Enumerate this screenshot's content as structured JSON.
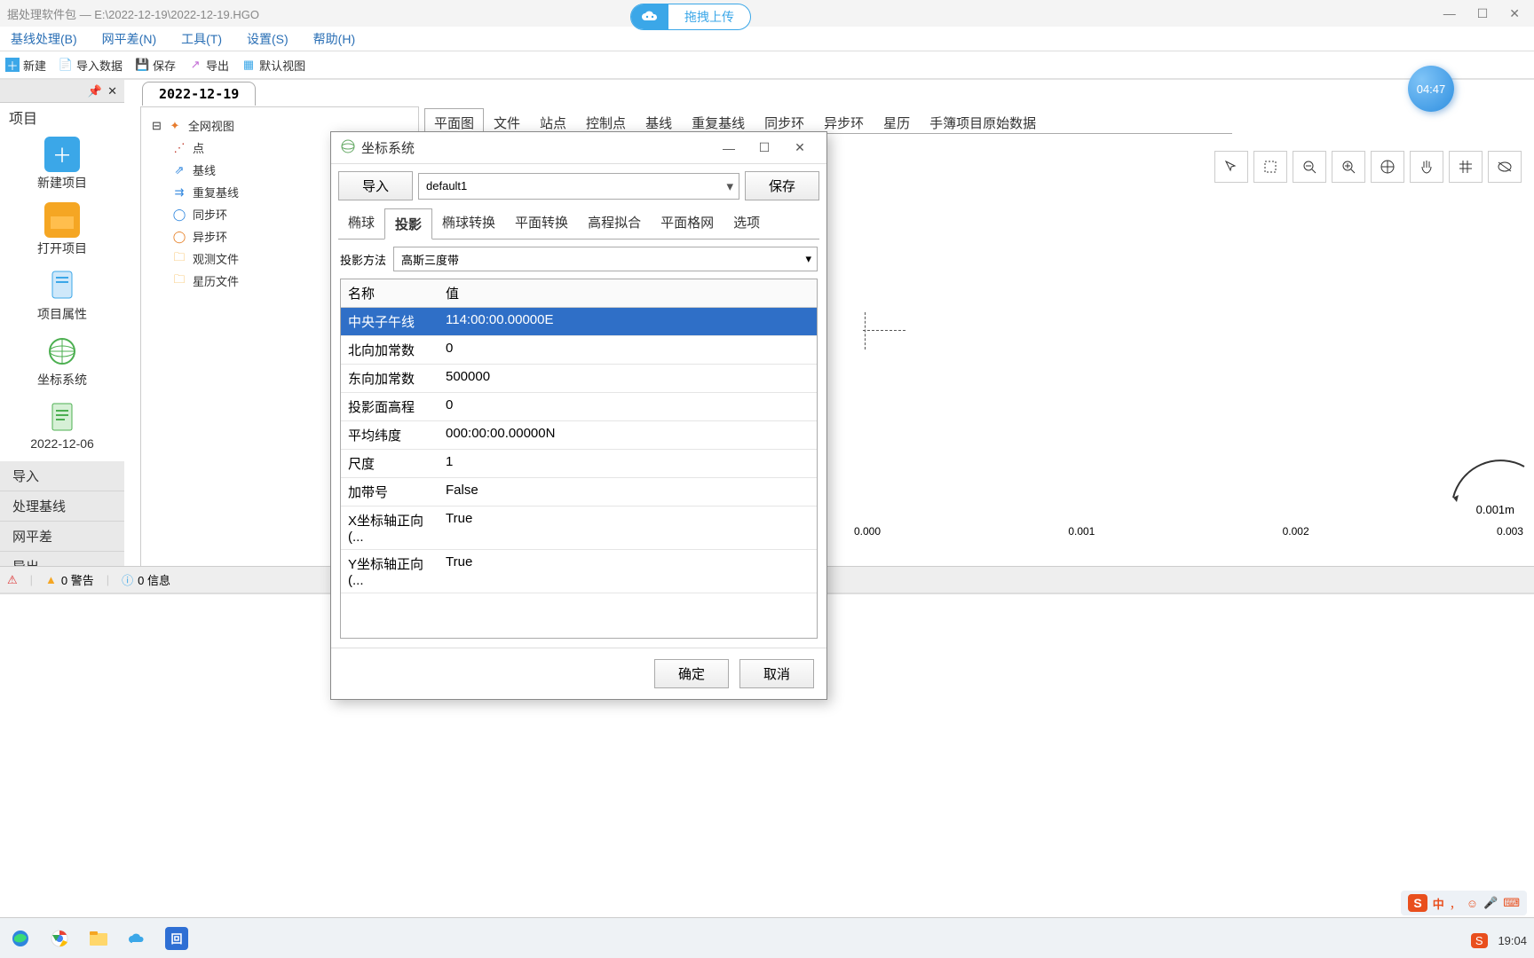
{
  "window": {
    "title": "据处理软件包 — E:\\2022-12-19\\2022-12-19.HGO",
    "upload_label": "拖拽上传"
  },
  "menu": {
    "items": [
      "基线处理(B)",
      "网平差(N)",
      "工具(T)",
      "设置(S)",
      "帮助(H)"
    ]
  },
  "toolbar": {
    "new": "新建",
    "import": "导入数据",
    "save": "保存",
    "export": "导出",
    "default_view": "默认视图"
  },
  "side": {
    "header": "项目",
    "pin": "📌",
    "items": [
      {
        "label": "新建项目"
      },
      {
        "label": "打开项目"
      },
      {
        "label": "项目属性"
      },
      {
        "label": "坐标系统"
      },
      {
        "label": "2022-12-06"
      }
    ],
    "actions": [
      "导入",
      "处理基线",
      "网平差",
      "导出"
    ]
  },
  "doc_tab": "2022-12-19",
  "tree": {
    "root": "全网视图",
    "children": [
      "点",
      "基线",
      "重复基线",
      "同步环",
      "异步环",
      "观测文件",
      "星历文件"
    ]
  },
  "map": {
    "tabs": [
      "平面图",
      "文件",
      "站点",
      "控制点",
      "基线",
      "重复基线",
      "同步环",
      "异步环",
      "星历",
      "手簿项目原始数据"
    ],
    "scale": "0.001m",
    "xticks": [
      "0.000",
      "0.001",
      "0.002",
      "0.003"
    ]
  },
  "dialog": {
    "title": "坐标系统",
    "import": "导入",
    "combo": "default1",
    "save": "保存",
    "tabs": [
      "椭球",
      "投影",
      "椭球转换",
      "平面转换",
      "高程拟合",
      "平面格网",
      "选项"
    ],
    "active_tab": 1,
    "proj_method_label": "投影方法",
    "proj_method_value": "高斯三度带",
    "col_name": "名称",
    "col_value": "值",
    "rows": [
      {
        "name": "中央子午线",
        "value": "114:00:00.00000E",
        "selected": true
      },
      {
        "name": "北向加常数",
        "value": "0"
      },
      {
        "name": "东向加常数",
        "value": "500000"
      },
      {
        "name": "投影面高程",
        "value": "0"
      },
      {
        "name": "平均纬度",
        "value": "000:00:00.00000N"
      },
      {
        "name": "尺度",
        "value": "1"
      },
      {
        "name": "加带号",
        "value": "False"
      },
      {
        "name": "X坐标轴正向(...",
        "value": "True"
      },
      {
        "name": "Y坐标轴正向(...",
        "value": "True"
      }
    ],
    "ok": "确定",
    "cancel": "取消"
  },
  "status": {
    "warn_count": "0 警告",
    "info_count": "0 信息"
  },
  "clock_badge": "04:47",
  "tray": {
    "ime": "中",
    "s": "S"
  },
  "clock": "19:04"
}
